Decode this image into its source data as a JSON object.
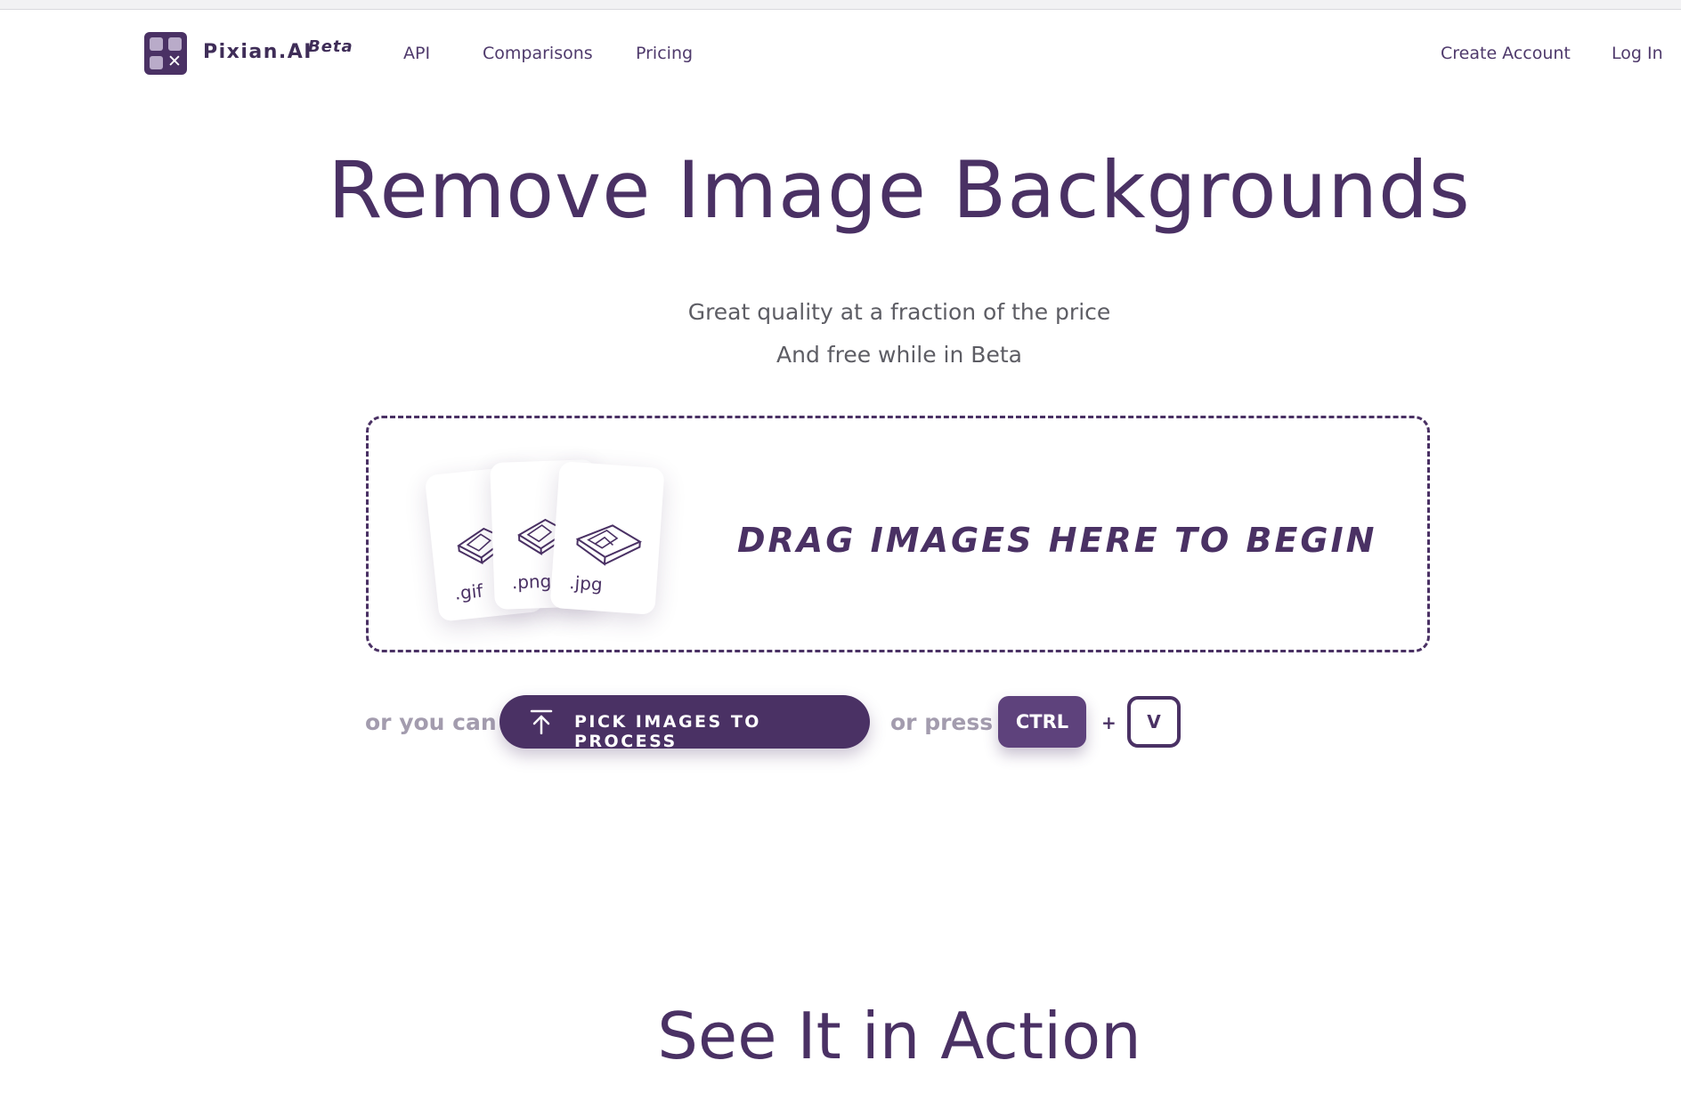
{
  "header": {
    "brand": "Pixian.AI",
    "badge": "Beta",
    "nav": {
      "api": "API",
      "comparisons": "Comparisons",
      "pricing": "Pricing",
      "create_account": "Create Account",
      "log_in": "Log In"
    }
  },
  "hero": {
    "title": "Remove Image Backgrounds",
    "subtitle_1": "Great quality at a fraction of the price",
    "subtitle_2": "And free while in Beta"
  },
  "dropzone": {
    "files": [
      ".gif",
      ".png",
      ".jpg"
    ],
    "prompt": "DRAG IMAGES HERE TO BEGIN"
  },
  "actions": {
    "or_you_can": "or you can",
    "pick_button": "PICK IMAGES TO PROCESS",
    "or_press": "or press",
    "key_1": "CTRL",
    "plus": "+",
    "key_2": "V"
  },
  "section": {
    "title": "See It in Action"
  },
  "colors": {
    "brand": "#4a3164",
    "muted_text": "#a39cae",
    "body_text": "#5d5d64"
  },
  "icons": [
    "logo-grid-icon",
    "image-file-icon",
    "upload-arrow-icon"
  ]
}
